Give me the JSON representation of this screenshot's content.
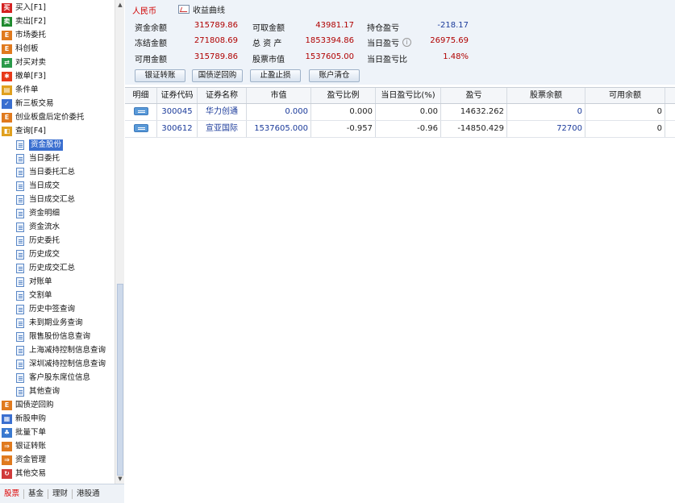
{
  "sidebar": {
    "items": [
      {
        "label": "买入[F1]",
        "icon": "buy-icon",
        "color": "#d42020",
        "glyph": "买"
      },
      {
        "label": "卖出[F2]",
        "icon": "sell-icon",
        "color": "#1e8a2e",
        "glyph": "卖"
      },
      {
        "label": "市场委托",
        "icon": "market-order-icon",
        "color": "#e07a1e",
        "glyph": "E"
      },
      {
        "label": "科创板",
        "icon": "star-board-icon",
        "color": "#e07a1e",
        "glyph": "E"
      },
      {
        "label": "对买对卖",
        "icon": "swap-icon",
        "color": "#2a9a4a",
        "glyph": "⇄"
      },
      {
        "label": "撤单[F3]",
        "icon": "cancel-order-icon",
        "color": "#e83a1a",
        "glyph": "✱"
      },
      {
        "label": "条件单",
        "icon": "condition-order-icon",
        "color": "#e0a01e",
        "glyph": "▤"
      },
      {
        "label": "新三板交易",
        "icon": "check-icon",
        "color": "#3a6fd0",
        "glyph": "✓"
      },
      {
        "label": "创业板盘后定价委托",
        "icon": "gem-after-hours-icon",
        "color": "#e07a1e",
        "glyph": "E"
      },
      {
        "label": "查询[F4]",
        "icon": "query-folder-icon",
        "color": "#e0a01e",
        "glyph": "◧"
      }
    ],
    "query_items": [
      "资金股份",
      "当日委托",
      "当日委托汇总",
      "当日成交",
      "当日成交汇总",
      "资金明细",
      "资金流水",
      "历史委托",
      "历史成交",
      "历史成交汇总",
      "对账单",
      "交割单",
      "历史中签查询",
      "未到期业务查询",
      "限售股份信息查询",
      "上海减持控制信息查询",
      "深圳减持控制信息查询",
      "客户股东席位信息",
      "其他查询"
    ],
    "bottom_items": [
      {
        "label": "国债逆回购",
        "icon": "repo-icon",
        "color": "#e07a1e",
        "glyph": "E"
      },
      {
        "label": "新股申购",
        "icon": "ipo-icon",
        "color": "#3a6fd0",
        "glyph": "▦"
      },
      {
        "label": "批量下单",
        "icon": "batch-order-icon",
        "color": "#3a7ad0",
        "glyph": "♣"
      },
      {
        "label": "银证转账",
        "icon": "bank-transfer-icon",
        "color": "#e07a1e",
        "glyph": "⇒"
      },
      {
        "label": "资金管理",
        "icon": "fund-manage-icon",
        "color": "#e07a1e",
        "glyph": "⇒"
      },
      {
        "label": "其他交易",
        "icon": "other-trade-icon",
        "color": "#d03a3a",
        "glyph": "↻"
      }
    ]
  },
  "bottom_tabs": [
    "股票",
    "基金",
    "理财",
    "港股通"
  ],
  "summary": {
    "currency": "人民币",
    "curve_link": "收益曲线",
    "rows": [
      [
        {
          "label": "资金余额",
          "value": "315789.86"
        },
        {
          "label": "可取金额",
          "value": "43981.17"
        },
        {
          "label": "持仓盈亏",
          "value": "-218.17"
        }
      ],
      [
        {
          "label": "冻结金额",
          "value": "271808.69"
        },
        {
          "label": "总 资 产",
          "value": "1853394.86"
        },
        {
          "label": "当日盈亏",
          "value": "26975.69"
        }
      ],
      [
        {
          "label": "可用金额",
          "value": "315789.86"
        },
        {
          "label": "股票市值",
          "value": "1537605.00"
        },
        {
          "label": "当日盈亏比",
          "value": "1.48%"
        }
      ]
    ],
    "info_glyph": "i",
    "buttons": [
      "银证转账",
      "国债逆回购",
      "止盈止损",
      "账户清仓"
    ]
  },
  "table": {
    "headers": [
      "明细",
      "证券代码",
      "证券名称",
      "市值",
      "盈亏比例",
      "当日盈亏比(%)",
      "盈亏",
      "股票余额",
      "可用余额"
    ],
    "rows": [
      {
        "code": "300045",
        "name": "华力创通",
        "market_value": "0.000",
        "pl_ratio": "0.000",
        "day_pl_ratio": "0.00",
        "pl": "14632.262",
        "balance": "0",
        "available": "0"
      },
      {
        "code": "300612",
        "name": "宣亚国际",
        "market_value": "1537605.000",
        "pl_ratio": "-0.957",
        "day_pl_ratio": "-0.96",
        "pl": "-14850.429",
        "balance": "72700",
        "available": "0"
      }
    ]
  }
}
